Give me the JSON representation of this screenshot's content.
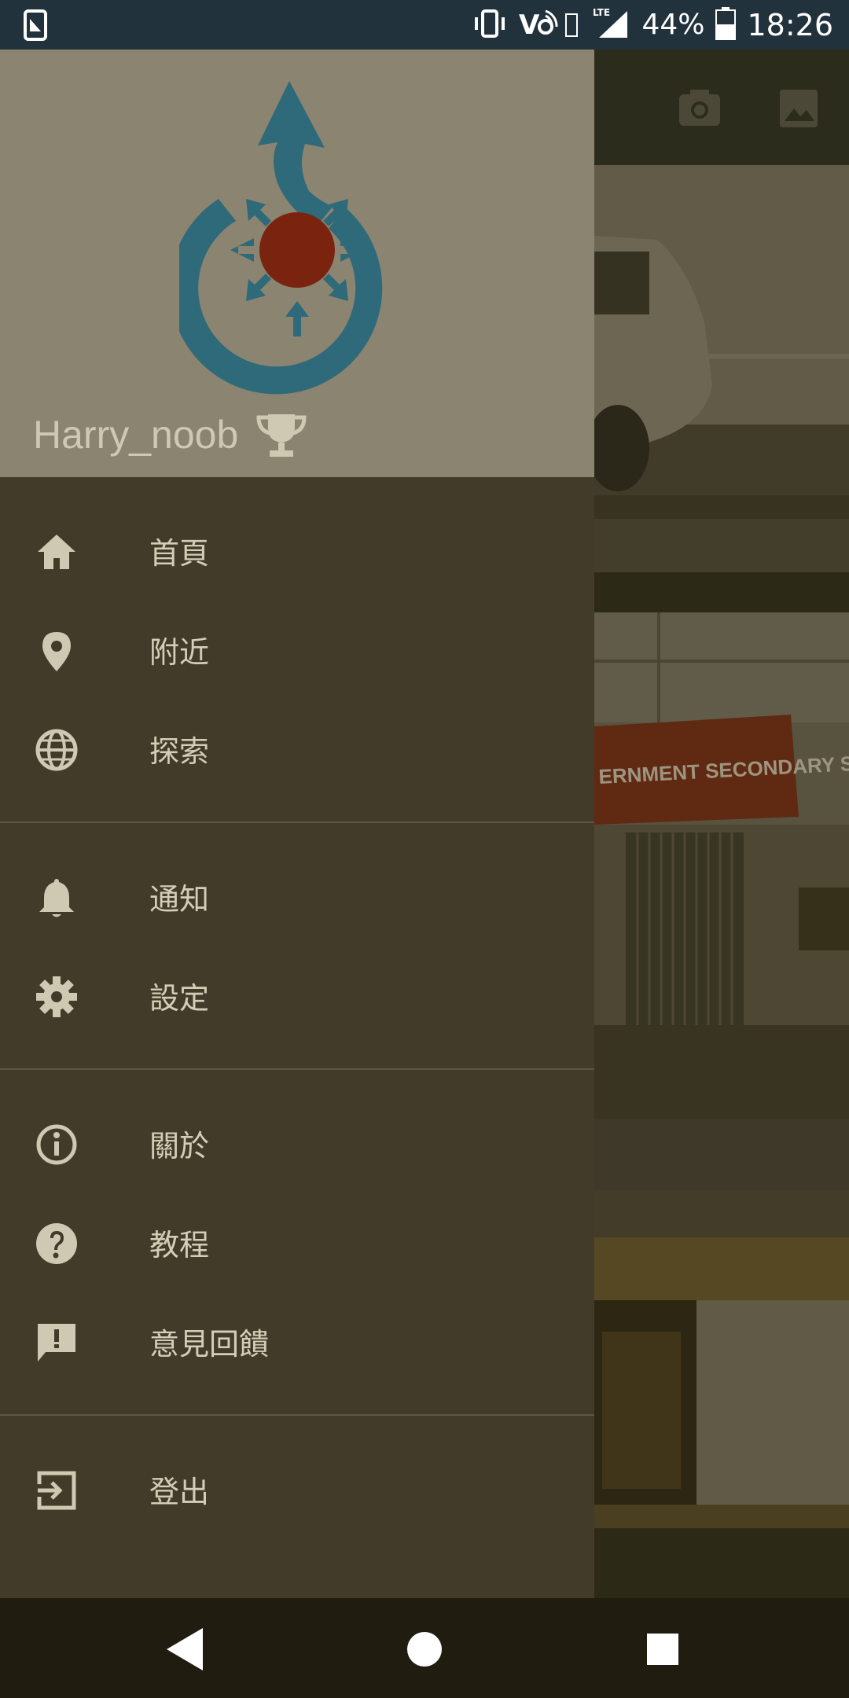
{
  "status_bar": {
    "battery": "44%",
    "time": "18:26",
    "network": "LTE"
  },
  "drawer": {
    "username": "Harry_noob",
    "sections": [
      [
        {
          "name": "home",
          "label": "首頁",
          "icon": "home-icon"
        },
        {
          "name": "nearby",
          "label": "附近",
          "icon": "location-pin-icon"
        },
        {
          "name": "explore",
          "label": "探索",
          "icon": "globe-icon"
        }
      ],
      [
        {
          "name": "notifications",
          "label": "通知",
          "icon": "bell-icon"
        },
        {
          "name": "settings",
          "label": "設定",
          "icon": "gear-icon"
        }
      ],
      [
        {
          "name": "about",
          "label": "關於",
          "icon": "info-icon"
        },
        {
          "name": "tutorial",
          "label": "教程",
          "icon": "help-icon"
        },
        {
          "name": "feedback",
          "label": "意見回饋",
          "icon": "feedback-icon"
        }
      ],
      [
        {
          "name": "logout",
          "label": "登出",
          "icon": "logout-icon"
        }
      ]
    ]
  },
  "background": {
    "sign_text": "ERNMENT SECONDARY SCHOOL"
  },
  "colors": {
    "status_bar": "#22323c",
    "drawer_header": "#8a8470",
    "drawer_body": "#433b29",
    "logo_blue": "#2f6a7a",
    "logo_red": "#7a2410",
    "text": "#d4ceb8"
  }
}
